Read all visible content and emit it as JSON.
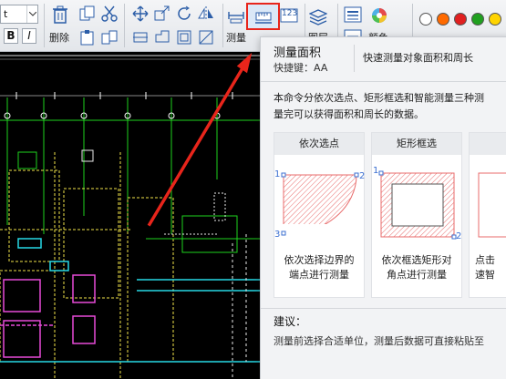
{
  "toolbar": {
    "font_value": "t",
    "bold_label": "B",
    "italic_label": "I",
    "delete_label": "删除",
    "measure_label": "测量",
    "layer_label": "图层",
    "color_label": "颜色",
    "area_badge": "123"
  },
  "tooltip": {
    "title": "测量面积",
    "shortcut": "快捷键：AA",
    "description": "快速测量对象面积和周长",
    "body_line1": "本命令分依次选点、矩形框选和智能测量三种测",
    "body_line2": "量完可以获得面积和周长的数据。",
    "modes": [
      {
        "title": "依次选点",
        "caption_line1": "依次选择边界的",
        "caption_line2": "端点进行测量",
        "p1": "1",
        "p2": "2",
        "p3": "3"
      },
      {
        "title": "矩形框选",
        "caption_line1": "依次框选矩形对",
        "caption_line2": "角点进行测量",
        "p1": "1",
        "p2": "2"
      },
      {
        "title": "智",
        "caption_line1": "点击",
        "caption_line2": "速智"
      }
    ],
    "suggestion_title": "建议：",
    "suggestion_text": "测量前选择合适单位，测量后数据可直接粘贴至"
  },
  "colors": {
    "swatches": [
      "#ffffff",
      "#ff6a00",
      "#e02020",
      "#20a020",
      "#ffd400"
    ],
    "highlight": "#e8251b",
    "arrow": "#e8251b"
  }
}
